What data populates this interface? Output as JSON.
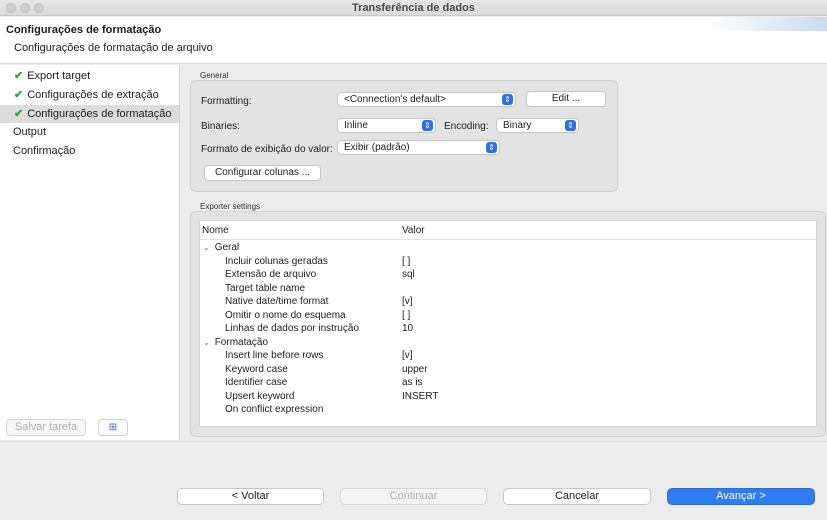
{
  "window": {
    "title": "Transferência de dados"
  },
  "header": {
    "title": "Configurações de formatação",
    "subtitle": "Configurações de formatação de arquivo"
  },
  "sidebar": {
    "items": [
      {
        "label": "Export target",
        "done": true,
        "selected": false
      },
      {
        "label": "Configurações de extração",
        "done": true,
        "selected": false
      },
      {
        "label": "Configurações de formatação",
        "done": true,
        "selected": true
      },
      {
        "label": "Output",
        "done": false,
        "selected": false
      },
      {
        "label": "Confirmação",
        "done": false,
        "selected": false
      }
    ],
    "save_task_label": "Salvar tarefa",
    "task_icon": "tasks-icon"
  },
  "general": {
    "group_label": "General",
    "formatting_label": "Formatting:",
    "formatting_value": "<Connection's default>",
    "edit_label": "Edit ...",
    "binaries_label": "Binaries:",
    "binaries_value": "Inline",
    "encoding_label": "Encoding:",
    "encoding_value": "Binary",
    "display_format_label": "Formato de exibição do valor:",
    "display_format_value": "Exibir (padrão)",
    "configure_columns_label": "Configurar colunas ..."
  },
  "exporter": {
    "group_label": "Exporter settings",
    "col_name": "Nome",
    "col_value": "Valor",
    "sections": [
      {
        "title": "Geral",
        "rows": [
          {
            "name": "Incluir colunas geradas",
            "value": "[ ]"
          },
          {
            "name": "Extensão de arquivo",
            "value": "sql"
          },
          {
            "name": "Target table name",
            "value": ""
          },
          {
            "name": "Native date/time format",
            "value": "[v]"
          },
          {
            "name": "Omitir o nome do esquema",
            "value": "[ ]"
          },
          {
            "name": "Linhas de dados por instrução",
            "value": "10"
          }
        ]
      },
      {
        "title": "Formatação",
        "rows": [
          {
            "name": "Insert line before rows",
            "value": "[v]"
          },
          {
            "name": "Keyword case",
            "value": "upper"
          },
          {
            "name": "Identifier case",
            "value": "as is"
          },
          {
            "name": "Upsert keyword",
            "value": "INSERT"
          },
          {
            "name": "On conflict expression",
            "value": ""
          }
        ]
      }
    ]
  },
  "footer": {
    "back_label": "< Voltar",
    "continue_label": "Continuar",
    "cancel_label": "Cancelar",
    "next_label": "Avançar >"
  },
  "colors": {
    "accent": "#2f7df0",
    "check": "#2f9e44"
  }
}
